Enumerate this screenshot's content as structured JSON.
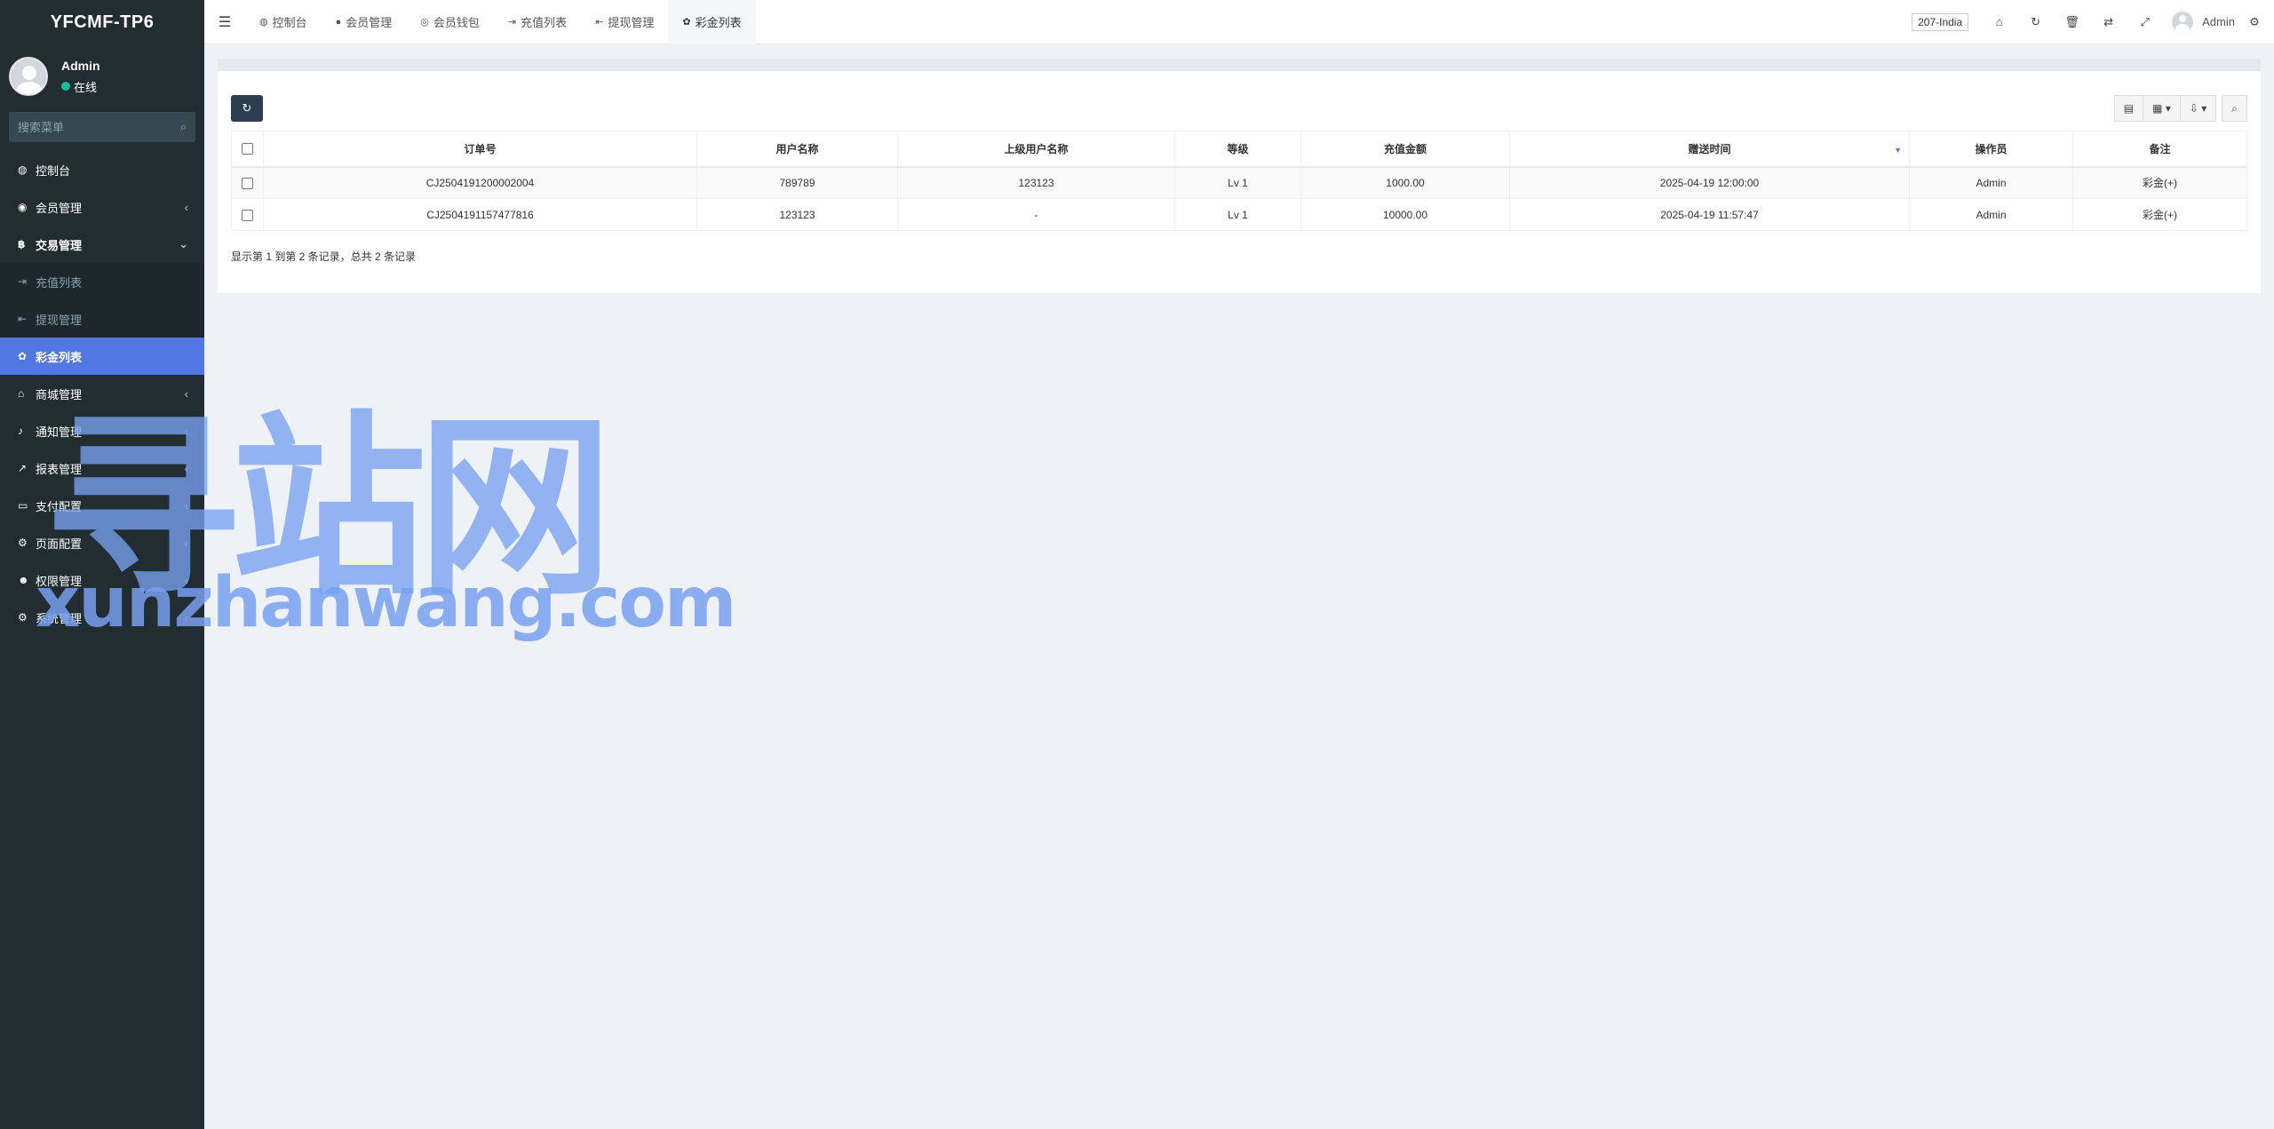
{
  "app": {
    "logo": "YFCMF-TP6"
  },
  "user": {
    "name": "Admin",
    "status": "在线"
  },
  "sidebar": {
    "search_placeholder": "搜索菜单",
    "items": [
      {
        "icon": "dashboard-icon",
        "glyph": "◍",
        "label": "控制台"
      },
      {
        "icon": "user-circle-icon",
        "glyph": "◉",
        "label": "会员管理",
        "chevron": "‹"
      },
      {
        "icon": "bitcoin-icon",
        "glyph": "฿",
        "label": "交易管理",
        "chevron": "⌄"
      },
      {
        "icon": "sign-in-icon",
        "glyph": "⇥",
        "label": "充值列表"
      },
      {
        "icon": "sign-out-icon",
        "glyph": "⇤",
        "label": "提现管理"
      },
      {
        "icon": "gift-icon",
        "glyph": "✿",
        "label": "彩金列表"
      },
      {
        "icon": "home-icon",
        "glyph": "⌂",
        "label": "商城管理",
        "chevron": "‹"
      },
      {
        "icon": "bell-icon",
        "glyph": "♪",
        "label": "通知管理",
        "chevron": "‹"
      },
      {
        "icon": "line-chart-icon",
        "glyph": "↗",
        "label": "报表管理",
        "chevron": "‹"
      },
      {
        "icon": "credit-card-icon",
        "glyph": "▭",
        "label": "支付配置",
        "chevron": "‹"
      },
      {
        "icon": "cog-icon",
        "glyph": "⚙",
        "label": "页面配置",
        "chevron": "‹"
      },
      {
        "icon": "users-icon",
        "glyph": "☻",
        "label": "权限管理",
        "chevron": "‹"
      },
      {
        "icon": "cogs-icon",
        "glyph": "⚙",
        "label": "系统管理",
        "chevron": "‹"
      }
    ]
  },
  "topbar": {
    "tabs": [
      {
        "icon": "dashboard-icon",
        "glyph": "◍",
        "label": "控制台"
      },
      {
        "icon": "user-icon",
        "glyph": "●",
        "label": "会员管理"
      },
      {
        "icon": "wallet-icon",
        "glyph": "◎",
        "label": "会员钱包"
      },
      {
        "icon": "sign-in-icon",
        "glyph": "⇥",
        "label": "充值列表"
      },
      {
        "icon": "sign-out-icon",
        "glyph": "⇤",
        "label": "提现管理"
      },
      {
        "icon": "gift-icon",
        "glyph": "✿",
        "label": "彩金列表"
      }
    ],
    "site_select": "207-India",
    "user": "Admin"
  },
  "table": {
    "headers": [
      "订单号",
      "用户名称",
      "上级用户名称",
      "等级",
      "充值金额",
      "赠送时间",
      "操作员",
      "备注"
    ],
    "rows": [
      [
        "CJ2504191200002004",
        "789789",
        "123123",
        "Lv 1",
        "1000.00",
        "2025-04-19 12:00:00",
        "Admin",
        "彩金(+)"
      ],
      [
        "CJ2504191157477816",
        "123123",
        "-",
        "Lv 1",
        "10000.00",
        "2025-04-19 11:57:47",
        "Admin",
        "彩金(+)"
      ]
    ],
    "pagination_info": "显示第 1 到第 2 条记录，总共 2 条记录"
  },
  "watermark": {
    "cn": "寻站网",
    "en": "xunzhanwang.com"
  }
}
